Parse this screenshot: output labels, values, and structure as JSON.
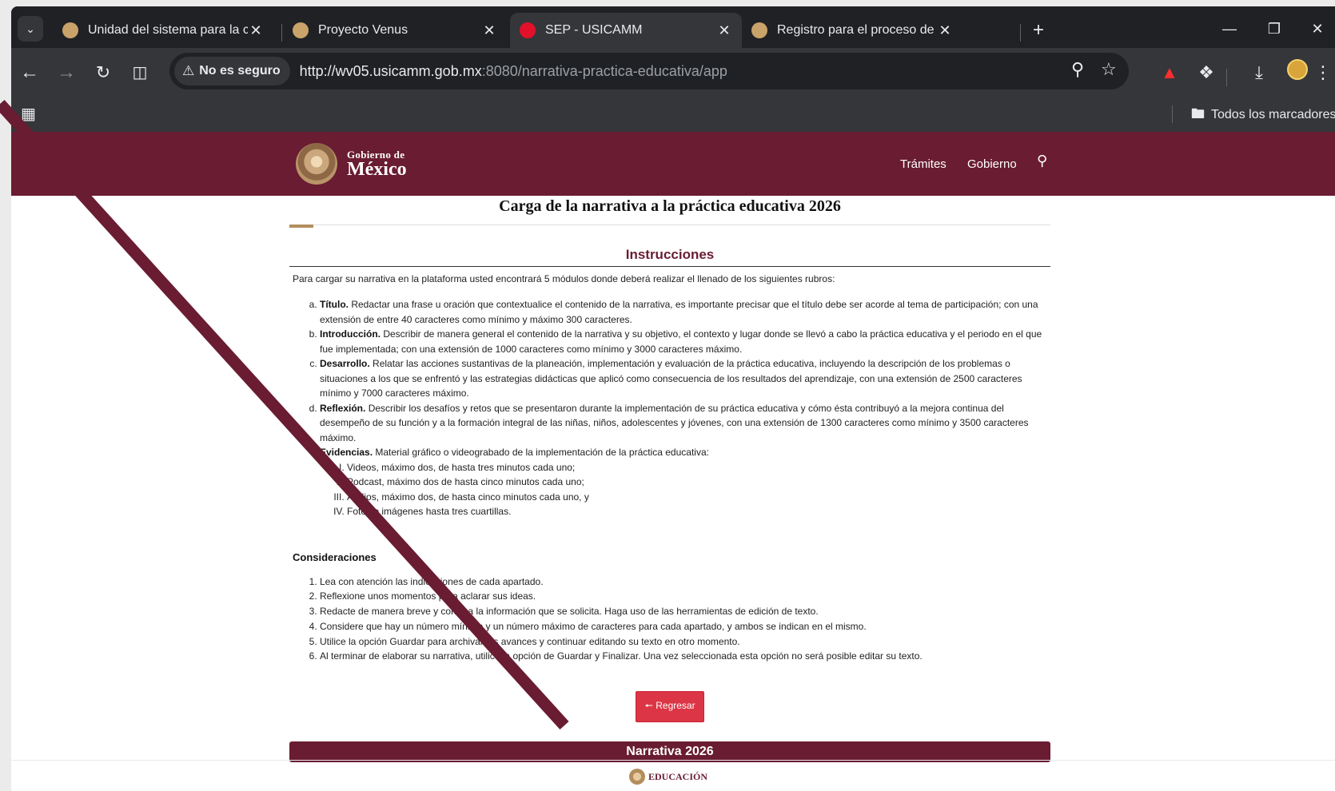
{
  "browser": {
    "tabs": [
      {
        "title": "Unidad del sistema para la carre",
        "favicon_color": "#c9a36a"
      },
      {
        "title": "Proyecto Venus",
        "favicon_color": "#c9a36a"
      },
      {
        "title": "SEP - USICAMM",
        "favicon_color": "#e3102a"
      },
      {
        "title": "Registro para el proceso de Prá",
        "favicon_color": "#c9a36a"
      }
    ],
    "tab_close_glyph": "✕",
    "new_tab_glyph": "+",
    "security_chip": "No es seguro",
    "url_host": "http://wv05.usicamm.gob.mx",
    "url_rest": ":8080/narrativa-practica-educativa/app",
    "bookmarks_all": "Todos los marcadores"
  },
  "icons": {
    "tab_search": "chevron-down-icon",
    "back": "arrow-left-icon",
    "forward": "arrow-right-icon",
    "reload": "reload-icon",
    "split": "split-view-icon",
    "warning": "warning-icon",
    "zoom": "zoom-icon",
    "star": "star-icon",
    "pdf": "pdf-icon",
    "extensions": "puzzle-icon",
    "download": "download-icon",
    "menu": "kebab-menu-icon",
    "apps": "apps-grid-icon",
    "folder": "folder-icon",
    "search": "search-icon"
  },
  "site": {
    "brand_small": "Gobierno de",
    "brand_big": "México",
    "nav": [
      "Trámites",
      "Gobierno"
    ],
    "colors": {
      "header": "#691c32",
      "accent": "#b38e5d",
      "button": "#dc3545"
    }
  },
  "page": {
    "title": "Carga de la narrativa a la práctica educativa 2026",
    "instructions_heading": "Instrucciones",
    "intro": "Para cargar su narrativa en la plataforma usted encontrará 5 módulos donde deberá realizar el llenado de los siguientes rubros:",
    "rubros": [
      {
        "term": "Título.",
        "text": " Redactar una frase u oración que contextualice el contenido de la narrativa, es importante precisar que el título debe ser acorde al tema de participación; con una extensión de entre 40 caracteres como mínimo y máximo 300 caracteres."
      },
      {
        "term": "Introducción.",
        "text": " Describir de manera general el contenido de la narrativa y su objetivo, el contexto y lugar donde se llevó a cabo la práctica educativa y el periodo en el que fue implementada; con una extensión de 1000 caracteres como mínimo y 3000 caracteres máximo."
      },
      {
        "term": "Desarrollo.",
        "text": " Relatar las acciones sustantivas de la planeación, implementación y evaluación de la práctica educativa, incluyendo la descripción de los problemas o situaciones a los que se enfrentó y las estrategias didácticas que aplicó como consecuencia de los resultados del aprendizaje, con una extensión de 2500 caracteres mínimo y 7000 caracteres máximo."
      },
      {
        "term": "Reflexión.",
        "text": " Describir los desafíos y retos que se presentaron durante la implementación de su práctica educativa y cómo ésta contribuyó a la mejora continua del desempeño de su función y a la formación integral de las niñas, niños, adolescentes y jóvenes, con una extensión de 1300 caracteres como mínimo y 3500 caracteres máximo."
      }
    ],
    "evidencias": {
      "term": "Evidencias.",
      "text": " Material gráfico o videograbado de la implementación de la práctica educativa:",
      "items": [
        "Videos, máximo dos, de hasta tres minutos cada uno;",
        "Podcast, máximo dos de hasta cinco minutos cada uno;",
        "Audios, máximo dos, de hasta cinco minutos cada uno, y",
        "Fotos o imágenes hasta tres cuartillas."
      ]
    },
    "considerations_heading": "Consideraciones",
    "considerations": [
      "Lea con atención las indicaciones de cada apartado.",
      "Reflexione unos momentos para aclarar sus ideas.",
      "Redacte de manera breve y concisa la información que se solicita. Haga uso de las herramientas de edición de texto.",
      "Considere que hay un número mínimo y un número máximo de caracteres para cada apartado, y ambos se indican en el mismo.",
      "Utilice la opción Guardar para archivar los avances y continuar editando su texto en otro momento.",
      "Al terminar de elaborar su narrativa, utilice la opción de Guardar y Finalizar. Una vez seleccionada esta opción no será posible editar su texto."
    ],
    "back_button": "Regresar",
    "narrativa_bar": "Narrativa 2026",
    "footer_brand": "EDUCACIÓN"
  }
}
